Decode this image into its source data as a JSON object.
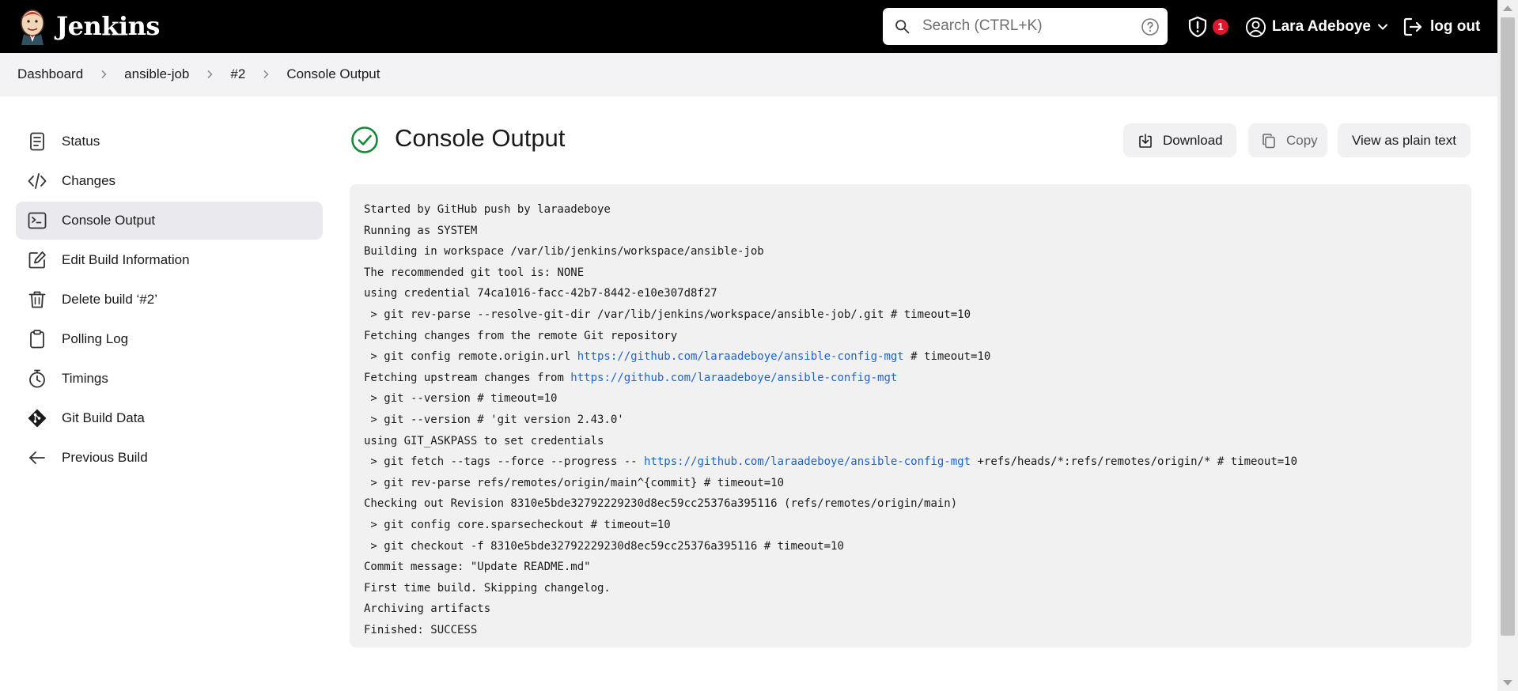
{
  "header": {
    "brand_name": "Jenkins",
    "search": {
      "placeholder": "Search (CTRL+K)",
      "value": ""
    },
    "security_badge_count": "1",
    "user_name": "Lara Adeboye",
    "logout_label": "log out"
  },
  "breadcrumb": [
    "Dashboard",
    "ansible-job",
    "#2",
    "Console Output"
  ],
  "sidebar": {
    "items": [
      {
        "label": "Status",
        "icon": "status-icon"
      },
      {
        "label": "Changes",
        "icon": "code-icon"
      },
      {
        "label": "Console Output",
        "icon": "terminal-icon",
        "active": true
      },
      {
        "label": "Edit Build Information",
        "icon": "edit-icon"
      },
      {
        "label": "Delete build ‘#2’",
        "icon": "trash-icon"
      },
      {
        "label": "Polling Log",
        "icon": "clipboard-icon"
      },
      {
        "label": "Timings",
        "icon": "stopwatch-icon"
      },
      {
        "label": "Git Build Data",
        "icon": "git-icon"
      },
      {
        "label": "Previous Build",
        "icon": "arrow-left-icon"
      }
    ]
  },
  "main": {
    "title": "Console Output",
    "status": "success",
    "actions": {
      "download": "Download",
      "copy": "Copy",
      "plain_text": "View as plain text"
    },
    "console_lines": [
      [
        {
          "t": "Started by GitHub push by laraadeboye"
        }
      ],
      [
        {
          "t": "Running as SYSTEM"
        }
      ],
      [
        {
          "t": "Building in workspace /var/lib/jenkins/workspace/ansible-job"
        }
      ],
      [
        {
          "t": "The recommended git tool is: NONE"
        }
      ],
      [
        {
          "t": "using credential 74ca1016-facc-42b7-8442-e10e307d8f27"
        }
      ],
      [
        {
          "t": " > git rev-parse --resolve-git-dir /var/lib/jenkins/workspace/ansible-job/.git # timeout=10"
        }
      ],
      [
        {
          "t": "Fetching changes from the remote Git repository"
        }
      ],
      [
        {
          "t": " > git config remote.origin.url "
        },
        {
          "t": "https://github.com/laraadeboye/ansible-config-mgt",
          "link": true
        },
        {
          "t": " # timeout=10"
        }
      ],
      [
        {
          "t": "Fetching upstream changes from "
        },
        {
          "t": "https://github.com/laraadeboye/ansible-config-mgt",
          "link": true
        }
      ],
      [
        {
          "t": " > git --version # timeout=10"
        }
      ],
      [
        {
          "t": " > git --version # 'git version 2.43.0'"
        }
      ],
      [
        {
          "t": "using GIT_ASKPASS to set credentials"
        }
      ],
      [
        {
          "t": " > git fetch --tags --force --progress -- "
        },
        {
          "t": "https://github.com/laraadeboye/ansible-config-mgt",
          "link": true
        },
        {
          "t": " +refs/heads/*:refs/remotes/origin/* # timeout=10"
        }
      ],
      [
        {
          "t": " > git rev-parse refs/remotes/origin/main^{commit} # timeout=10"
        }
      ],
      [
        {
          "t": "Checking out Revision 8310e5bde32792229230d8ec59cc25376a395116 (refs/remotes/origin/main)"
        }
      ],
      [
        {
          "t": " > git config core.sparsecheckout # timeout=10"
        }
      ],
      [
        {
          "t": " > git checkout -f 8310e5bde32792229230d8ec59cc25376a395116 # timeout=10"
        }
      ],
      [
        {
          "t": "Commit message: \"Update README.md\""
        }
      ],
      [
        {
          "t": "First time build. Skipping changelog."
        }
      ],
      [
        {
          "t": "Archiving artifacts"
        }
      ],
      [
        {
          "t": "Finished: SUCCESS"
        }
      ]
    ]
  },
  "colors": {
    "header_bg": "#000000",
    "badge": "#e0172b",
    "success": "#138a36",
    "link": "#1e64c8"
  }
}
